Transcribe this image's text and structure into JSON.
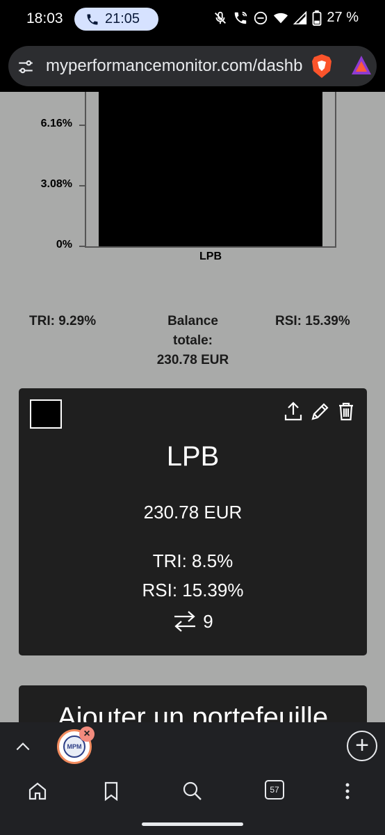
{
  "status_bar": {
    "time": "18:03",
    "call_timer": "21:05",
    "battery": "27 %"
  },
  "browser": {
    "url": "myperformancemonitor.com/dashboard"
  },
  "chart_data": {
    "type": "bar",
    "categories": [
      "LPB"
    ],
    "values": [
      9.24
    ],
    "ylim": [
      0,
      9.24
    ],
    "ytick_labels": [
      "0%",
      "3.08%",
      "6.16%"
    ],
    "xlabel": "",
    "ylabel": "",
    "bar_color": "#000000"
  },
  "summary": {
    "tri": "TRI: 9.29%",
    "balance_line1": "Balance",
    "balance_line2": "totale:",
    "balance_value": "230.78 EUR",
    "rsi": "RSI: 15.39%"
  },
  "portfolio_card": {
    "name": "LPB",
    "amount": "230.78 EUR",
    "tri": "TRI: 8.5%",
    "rsi": "RSI: 15.39%",
    "trades": "9",
    "swatch_color": "#000000"
  },
  "add_portfolio": {
    "title": "Ajouter un portefeuille"
  },
  "tab_strip": {
    "tab_favicon_text": "MPM"
  },
  "toolbar": {
    "tab_count": "57"
  }
}
